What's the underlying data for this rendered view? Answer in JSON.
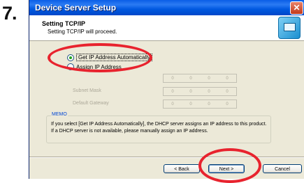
{
  "step": "7.",
  "window": {
    "title": "Device Server Setup",
    "close_glyph": "✕"
  },
  "header": {
    "title": "Setting TCP/IP",
    "subtitle": "Setting TCP/IP will proceed.",
    "icon": "network-computer-icon"
  },
  "options": {
    "auto": {
      "label": "Get IP Address Automatically",
      "selected": true
    },
    "manual": {
      "label": "Assign IP Address",
      "selected": false
    }
  },
  "fields": {
    "subnet_mask": "Subnet Mask",
    "default_gateway": "Default Gateway",
    "octet": "0"
  },
  "memo": {
    "label": "MEMO",
    "text": "If you select [Get IP Address Automatically], the DHCP server assigns an IP address to this product. If a DHCP server is not available, please manually assign an IP address."
  },
  "buttons": {
    "back": "< Back",
    "next": "Next >",
    "cancel": "Cancel"
  },
  "colors": {
    "highlight_ring": "#e8232e",
    "titlebar": "#0058e0"
  }
}
